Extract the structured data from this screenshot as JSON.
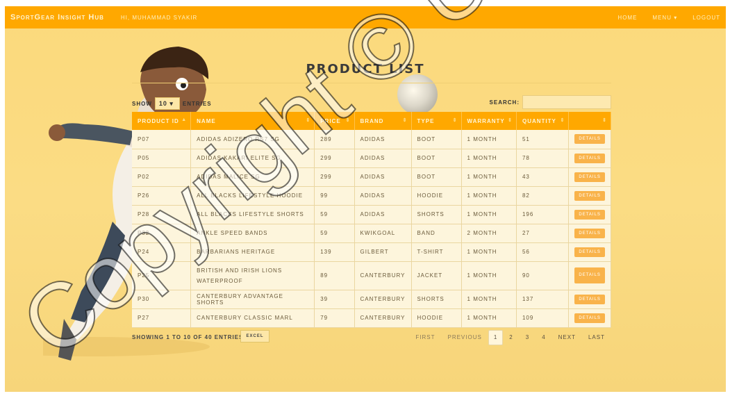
{
  "navbar": {
    "brand": "SportGear Insight Hub",
    "greeting": "Hi, Muhammad Syakir",
    "links": [
      "Home",
      "Menu ▾",
      "Logout"
    ]
  },
  "page": {
    "title": "PRODUCT LIST"
  },
  "controls": {
    "show_label": "Show",
    "entries_value": "10",
    "entries_label": "entries",
    "search_label": "Search:",
    "search_value": ""
  },
  "table": {
    "columns": [
      "Product ID",
      "Name",
      "Price",
      "Brand",
      "Type",
      "Warranty",
      "Quantity",
      ""
    ],
    "rows": [
      {
        "id": "P07",
        "name": "Adidas Adizero RS7 SG",
        "price": "289",
        "brand": "Adidas",
        "type": "Boot",
        "warranty": "1 month",
        "qty": "51"
      },
      {
        "id": "P05",
        "name": "Adidas Kakari Elite SG",
        "price": "299",
        "brand": "Adidas",
        "type": "Boot",
        "warranty": "1 month",
        "qty": "78"
      },
      {
        "id": "P02",
        "name": "Adidas Malice SG",
        "price": "299",
        "brand": "Adidas",
        "type": "Boot",
        "warranty": "1 month",
        "qty": "43"
      },
      {
        "id": "P26",
        "name": "All Blacks Lifestyle Hoodie",
        "price": "99",
        "brand": "Adidas",
        "type": "Hoodie",
        "warranty": "1 month",
        "qty": "82"
      },
      {
        "id": "P28",
        "name": "All Blacks Lifestyle Shorts",
        "price": "59",
        "brand": "Adidas",
        "type": "Shorts",
        "warranty": "1 month",
        "qty": "196"
      },
      {
        "id": "P32",
        "name": "Ankle Speed Bands",
        "price": "59",
        "brand": "KwikGoal",
        "type": "Band",
        "warranty": "2 month",
        "qty": "27"
      },
      {
        "id": "P24",
        "name": "Barbarians Heritage",
        "price": "139",
        "brand": "Gilbert",
        "type": "T-Shirt",
        "warranty": "1 month",
        "qty": "56"
      },
      {
        "id": "P25",
        "name": "British and Irish Lions Waterproof",
        "price": "89",
        "brand": "Canterbury",
        "type": "Jacket",
        "warranty": "1 month",
        "qty": "90"
      },
      {
        "id": "P30",
        "name": "Canterbury Advantage Shorts",
        "price": "39",
        "brand": "Canterbury",
        "type": "Shorts",
        "warranty": "1 month",
        "qty": "137"
      },
      {
        "id": "P27",
        "name": "Canterbury Classic Marl",
        "price": "79",
        "brand": "Canterbury",
        "type": "Hoodie",
        "warranty": "1 month",
        "qty": "109"
      }
    ],
    "details_label": "Details"
  },
  "footer": {
    "info": "Showing 1 to 10 of 40 entries",
    "excel_label": "Excel",
    "pager": {
      "first": "First",
      "previous": "Previous",
      "pages": [
        "1",
        "2",
        "3",
        "4"
      ],
      "next": "Next",
      "last": "Last"
    }
  },
  "watermark": {
    "text": "Copyright © UKM"
  },
  "colors": {
    "navbar": "#ffa800",
    "background": "#fbd97c",
    "details_button": "#f9b34a"
  }
}
